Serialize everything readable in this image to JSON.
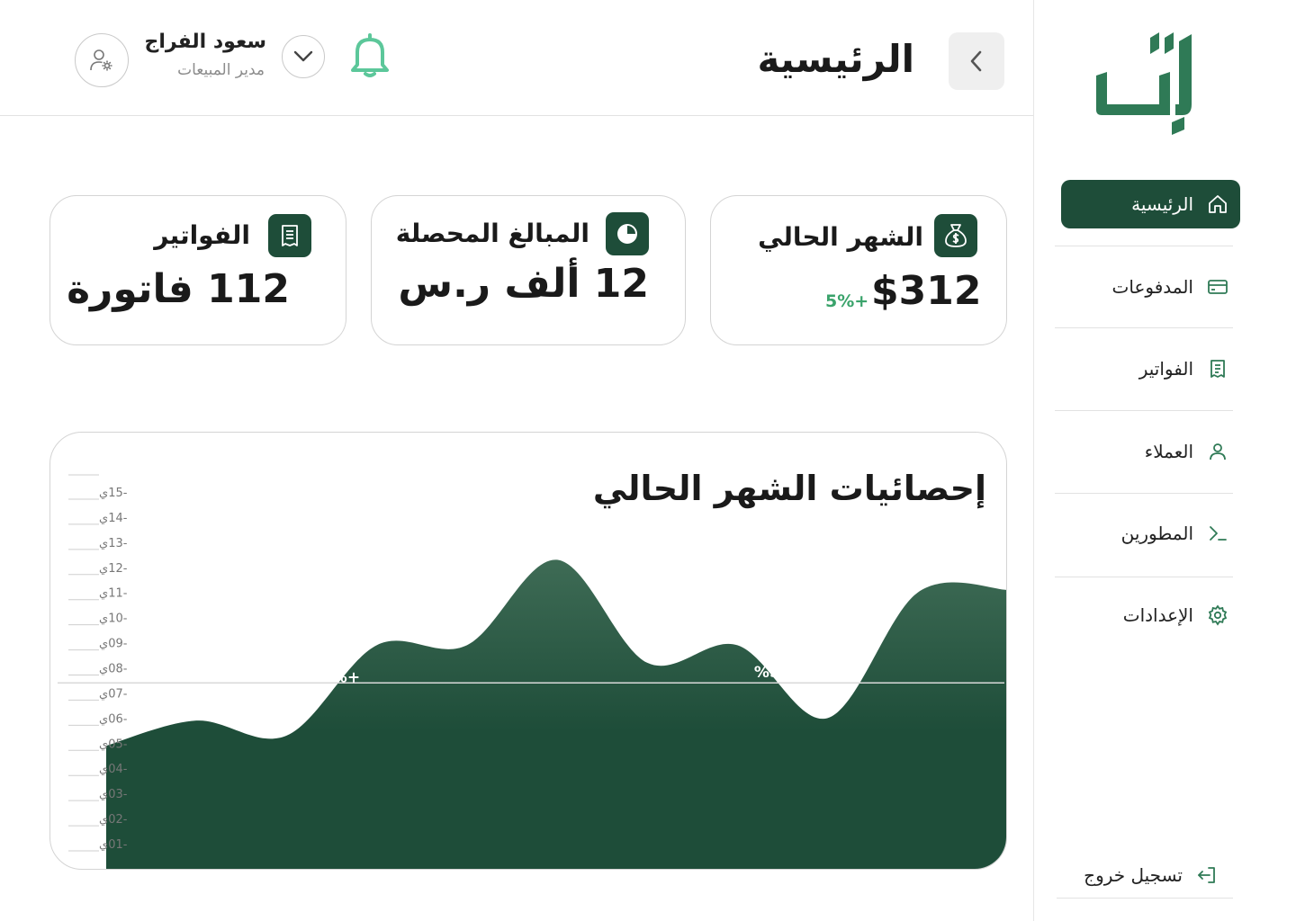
{
  "brand": {
    "logo_text": "تِل",
    "accent_color": "#1e4d39",
    "light_accent": "#5cc79a"
  },
  "sidebar": {
    "items": [
      {
        "label": "الرئيسية",
        "icon": "home-icon",
        "active": true
      },
      {
        "label": "المدفوعات",
        "icon": "credit-card-icon",
        "active": false
      },
      {
        "label": "الفواتير",
        "icon": "invoice-icon",
        "active": false
      },
      {
        "label": "العملاء",
        "icon": "user-icon",
        "active": false
      },
      {
        "label": "المطورين",
        "icon": "terminal-icon",
        "active": false
      },
      {
        "label": "الإعدادات",
        "icon": "gear-icon",
        "active": false
      }
    ],
    "logout_label": "تسجيل خروج"
  },
  "header": {
    "title": "الرئيسية",
    "user_name": "سعود الفراج",
    "user_role": "مدير المبيعات"
  },
  "cards": {
    "current_month": {
      "title": "الشهر الحالي",
      "value": "$312",
      "trend": "+5%"
    },
    "collected": {
      "title": "المبالغ المحصلة",
      "value": "12 ألف ر.س"
    },
    "invoices": {
      "title": "الفواتير",
      "value": "112 فاتورة"
    }
  },
  "chart_data": {
    "type": "area",
    "title": "إحصائيات الشهر الحالي",
    "y_ticks": [
      "-01ي",
      "-02ي",
      "-03ي",
      "-04ي",
      "-05ي",
      "-06ي",
      "-07ي",
      "-08ي",
      "-09ي",
      "-10ي",
      "-11ي",
      "-12ي",
      "-13ي",
      "-14ي",
      "-15ي"
    ],
    "x": [
      0,
      1,
      2,
      3,
      4,
      5,
      6,
      7,
      8,
      9,
      10
    ],
    "values": [
      4.9,
      5.9,
      5.3,
      8.9,
      8.9,
      12.3,
      8.2,
      8.9,
      6.0,
      11.0,
      11.1
    ],
    "ylim": [
      0.4,
      15.7
    ],
    "reference_line": 7.4,
    "annotations": [
      {
        "text": "3%+",
        "x": 2.6,
        "y": 7.5
      },
      {
        "text": "%5+",
        "x": 7.4,
        "y": 7.7
      }
    ],
    "fill_color": "#1e4d39"
  }
}
